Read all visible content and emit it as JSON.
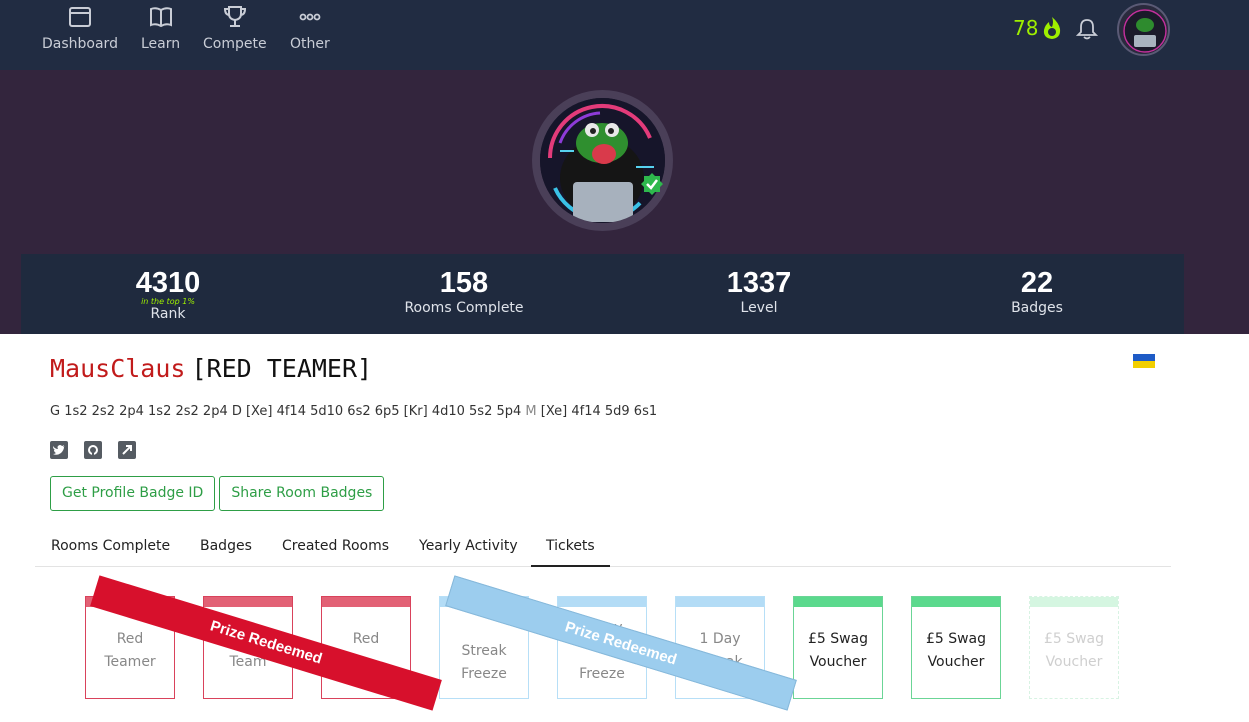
{
  "nav": {
    "items": [
      {
        "label": "Dashboard",
        "icon": "browser-window-icon"
      },
      {
        "label": "Learn",
        "icon": "open-book-icon"
      },
      {
        "label": "Compete",
        "icon": "trophy-icon"
      },
      {
        "label": "Other",
        "icon": "ellipsis-icon"
      }
    ],
    "streak": "78",
    "colors": {
      "bg": "#212c42",
      "streak": "#9fef00"
    }
  },
  "stats": {
    "rank": {
      "value": "4310",
      "note": "in the top 1%",
      "label": "Rank"
    },
    "rooms": {
      "value": "158",
      "label": "Rooms Complete"
    },
    "level": {
      "value": "1337",
      "label": "Level"
    },
    "badges": {
      "value": "22",
      "label": "Badges"
    }
  },
  "profile": {
    "username": "MausClaus",
    "title": "[RED TEAMER]",
    "bio_a": "G 1s2 2s2 2p4 1s2 2s2 2p4 D [Xe] 4f14 5d10 6s2 6p5 [Kr] 4d10 5s2 5p4 ",
    "bio_m": "M",
    "bio_b": " [Xe] 4f14 5d9 6s1",
    "buttons": {
      "badge_id": "Get Profile Badge ID",
      "share": "Share Room Badges"
    }
  },
  "tabs": [
    "Rooms Complete",
    "Badges",
    "Created Rooms",
    "Yearly Activity",
    "Tickets"
  ],
  "active_tab": "Tickets",
  "tickets": [
    {
      "l1": "Red",
      "l2": "Teamer"
    },
    {
      "l1": "",
      "l2": "Team"
    },
    {
      "l1": "Red",
      "l2": ""
    },
    {
      "l1": "",
      "l2": "Streak",
      "l3": "Freeze"
    },
    {
      "l1": "1 Day",
      "l2": "",
      "l3": "Freeze"
    },
    {
      "l1": "1 Day",
      "l2": "Streak"
    },
    {
      "l1": "£5 Swag",
      "l2": "Voucher"
    },
    {
      "l1": "£5 Swag",
      "l2": "Voucher"
    },
    {
      "l1": "£5 Swag",
      "l2": "Voucher"
    }
  ],
  "ribbons": {
    "red": "Prize Redeemed",
    "blue": "Prize Redeemed"
  }
}
